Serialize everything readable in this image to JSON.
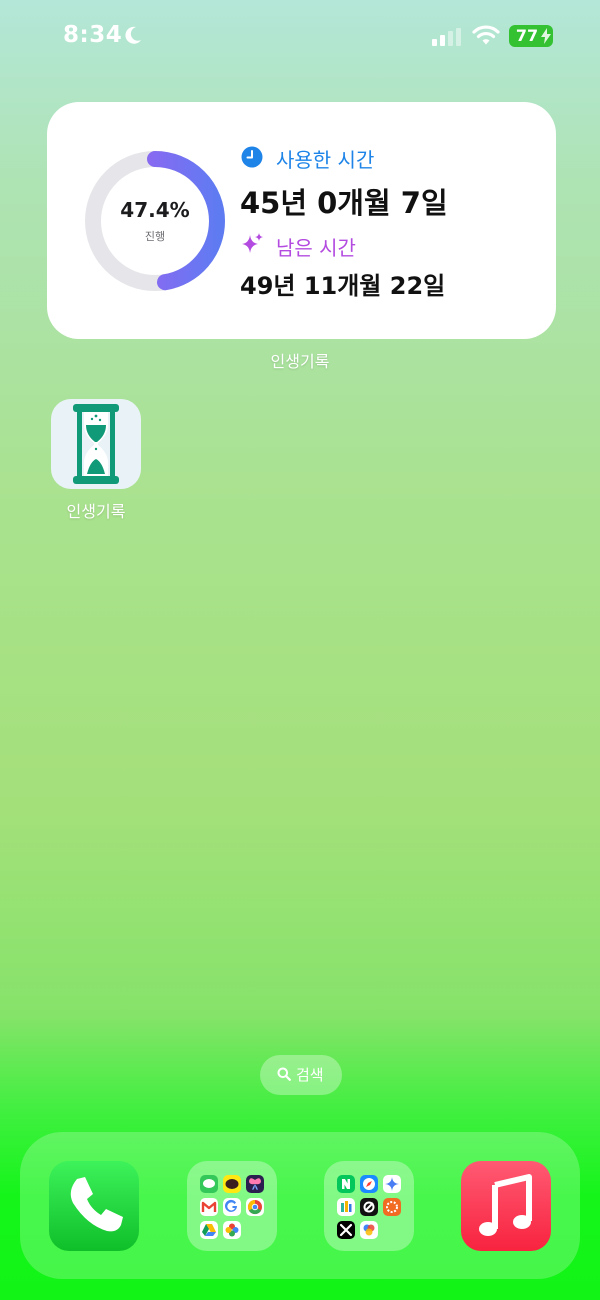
{
  "status_bar": {
    "time": "8:34",
    "battery": "77",
    "icons": [
      "moon-icon",
      "cellular-signal-icon",
      "wifi-icon",
      "battery-charging-icon"
    ]
  },
  "widget": {
    "progress_percent": "47.4%",
    "progress_fraction": 0.474,
    "progress_label": "진행",
    "used_label": "사용한 시간",
    "used_value": "45년 0개월 7일",
    "remaining_label": "남은 시간",
    "remaining_value": "49년 11개월 22일",
    "caption": "인생기록",
    "colors": {
      "used": "#1e84e8",
      "remaining": "#b44be0",
      "ring_start": "#5f7bf2",
      "ring_end": "#a95cf0",
      "track": "#e6e6ea"
    }
  },
  "home_apps": [
    {
      "label": "인생기록",
      "icon": "hourglass-icon"
    }
  ],
  "search": {
    "label": "검색",
    "icon": "search-icon"
  },
  "dock": {
    "apps": [
      {
        "name": "phone",
        "icon": "phone-icon"
      },
      {
        "name": "folder",
        "icon": "folder-icon"
      },
      {
        "name": "folder",
        "icon": "folder-icon"
      },
      {
        "name": "music",
        "icon": "music-note-icon"
      }
    ]
  }
}
